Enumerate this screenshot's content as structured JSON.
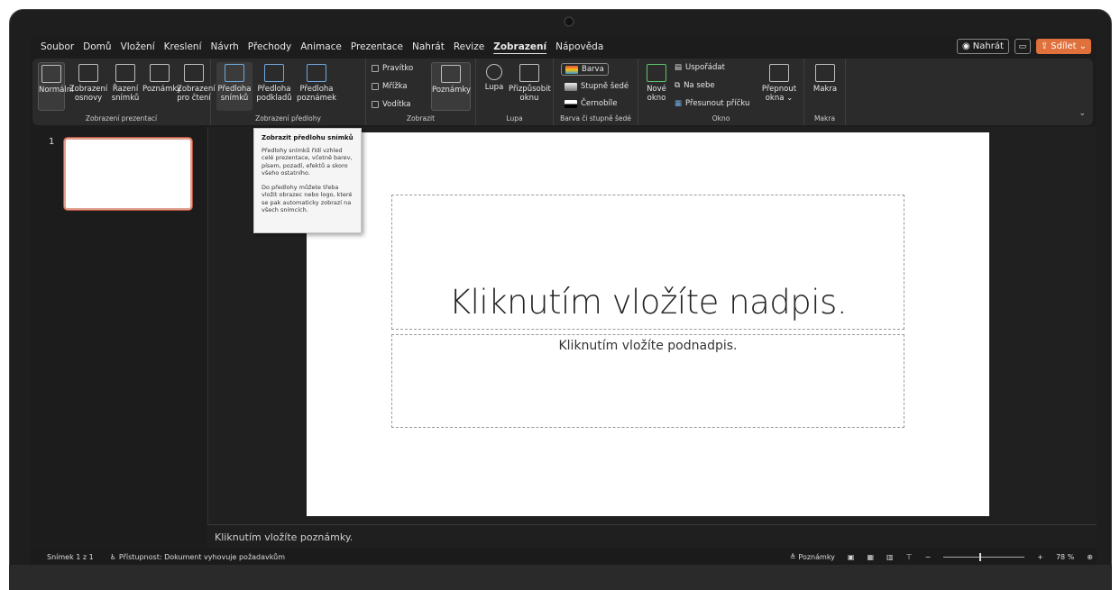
{
  "menu": {
    "items": [
      "Soubor",
      "Domů",
      "Vložení",
      "Kreslení",
      "Návrh",
      "Přechody",
      "Animace",
      "Prezentace",
      "Nahrát",
      "Revize",
      "Zobrazení",
      "Nápověda"
    ],
    "active": "Zobrazení",
    "record_label": "Nahrát",
    "share_label": "Sdílet"
  },
  "ribbon": {
    "groups": {
      "presentation_views": "Zobrazení prezentací",
      "master_views": "Zobrazení předlohy",
      "show": "Zobrazit",
      "zoom": "Lupa",
      "color": "Barva či stupně šedé",
      "window": "Okno",
      "macros": "Makra"
    },
    "buttons": {
      "normal": "Normální",
      "outline": "Zobrazení osnovy",
      "sorter": "Řazení snímků",
      "notes_page": "Poznámky",
      "reading": "Zobrazení pro čtení",
      "slide_master": "Předloha snímků",
      "handout_master": "Předloha podkladů",
      "notes_master": "Předloha poznámek",
      "ruler": "Pravítko",
      "gridlines": "Mřížka",
      "guides": "Vodítka",
      "notes": "Poznámky",
      "zoom": "Lupa",
      "fit": "Přizpůsobit oknu",
      "color": "Barva",
      "grayscale": "Stupně šedé",
      "bw": "Černobíle",
      "new_window": "Nové okno",
      "arrange": "Uspořádat",
      "cascade": "Na sebe",
      "move_split": "Přesunout příčku",
      "switch": "Přepnout okna",
      "macros": "Makra"
    }
  },
  "thumbnails": [
    {
      "number": "1"
    }
  ],
  "slide": {
    "title_placeholder": "Kliknutím vložíte nadpis.",
    "subtitle_placeholder": "Kliknutím vložíte podnadpis."
  },
  "notes_placeholder": "Kliknutím vložíte poznámky.",
  "tooltip": {
    "title": "Zobrazit předlohu snímků",
    "p1": "Předlohy snímků řídí vzhled celé prezentace, včetně barev, písem, pozadí, efektů a skoro všeho ostatního.",
    "p2": "Do předlohy můžete třeba vložit obrazec nebo logo, které se pak automaticky zobrazí na všech snímcích."
  },
  "status": {
    "slide_info": "Snímek 1 z 1",
    "accessibility": "Přístupnost: Dokument vyhovuje požadavkům",
    "notes_label": "Poznámky",
    "zoom": "78 %"
  },
  "colors": {
    "accent": "#e0703c",
    "ribbon_bg": "#2b2b2b",
    "app_bg": "#1c1c1c"
  }
}
